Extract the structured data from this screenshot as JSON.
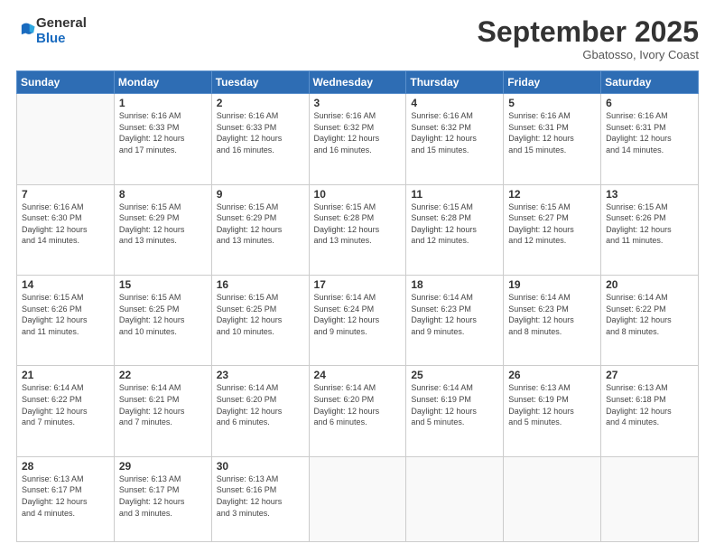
{
  "logo": {
    "general": "General",
    "blue": "Blue"
  },
  "header": {
    "month": "September 2025",
    "location": "Gbatosso, Ivory Coast"
  },
  "days_header": [
    "Sunday",
    "Monday",
    "Tuesday",
    "Wednesday",
    "Thursday",
    "Friday",
    "Saturday"
  ],
  "weeks": [
    [
      {
        "day": "",
        "info": ""
      },
      {
        "day": "1",
        "info": "Sunrise: 6:16 AM\nSunset: 6:33 PM\nDaylight: 12 hours\nand 17 minutes."
      },
      {
        "day": "2",
        "info": "Sunrise: 6:16 AM\nSunset: 6:33 PM\nDaylight: 12 hours\nand 16 minutes."
      },
      {
        "day": "3",
        "info": "Sunrise: 6:16 AM\nSunset: 6:32 PM\nDaylight: 12 hours\nand 16 minutes."
      },
      {
        "day": "4",
        "info": "Sunrise: 6:16 AM\nSunset: 6:32 PM\nDaylight: 12 hours\nand 15 minutes."
      },
      {
        "day": "5",
        "info": "Sunrise: 6:16 AM\nSunset: 6:31 PM\nDaylight: 12 hours\nand 15 minutes."
      },
      {
        "day": "6",
        "info": "Sunrise: 6:16 AM\nSunset: 6:31 PM\nDaylight: 12 hours\nand 14 minutes."
      }
    ],
    [
      {
        "day": "7",
        "info": "Sunrise: 6:16 AM\nSunset: 6:30 PM\nDaylight: 12 hours\nand 14 minutes."
      },
      {
        "day": "8",
        "info": "Sunrise: 6:15 AM\nSunset: 6:29 PM\nDaylight: 12 hours\nand 13 minutes."
      },
      {
        "day": "9",
        "info": "Sunrise: 6:15 AM\nSunset: 6:29 PM\nDaylight: 12 hours\nand 13 minutes."
      },
      {
        "day": "10",
        "info": "Sunrise: 6:15 AM\nSunset: 6:28 PM\nDaylight: 12 hours\nand 13 minutes."
      },
      {
        "day": "11",
        "info": "Sunrise: 6:15 AM\nSunset: 6:28 PM\nDaylight: 12 hours\nand 12 minutes."
      },
      {
        "day": "12",
        "info": "Sunrise: 6:15 AM\nSunset: 6:27 PM\nDaylight: 12 hours\nand 12 minutes."
      },
      {
        "day": "13",
        "info": "Sunrise: 6:15 AM\nSunset: 6:26 PM\nDaylight: 12 hours\nand 11 minutes."
      }
    ],
    [
      {
        "day": "14",
        "info": "Sunrise: 6:15 AM\nSunset: 6:26 PM\nDaylight: 12 hours\nand 11 minutes."
      },
      {
        "day": "15",
        "info": "Sunrise: 6:15 AM\nSunset: 6:25 PM\nDaylight: 12 hours\nand 10 minutes."
      },
      {
        "day": "16",
        "info": "Sunrise: 6:15 AM\nSunset: 6:25 PM\nDaylight: 12 hours\nand 10 minutes."
      },
      {
        "day": "17",
        "info": "Sunrise: 6:14 AM\nSunset: 6:24 PM\nDaylight: 12 hours\nand 9 minutes."
      },
      {
        "day": "18",
        "info": "Sunrise: 6:14 AM\nSunset: 6:23 PM\nDaylight: 12 hours\nand 9 minutes."
      },
      {
        "day": "19",
        "info": "Sunrise: 6:14 AM\nSunset: 6:23 PM\nDaylight: 12 hours\nand 8 minutes."
      },
      {
        "day": "20",
        "info": "Sunrise: 6:14 AM\nSunset: 6:22 PM\nDaylight: 12 hours\nand 8 minutes."
      }
    ],
    [
      {
        "day": "21",
        "info": "Sunrise: 6:14 AM\nSunset: 6:22 PM\nDaylight: 12 hours\nand 7 minutes."
      },
      {
        "day": "22",
        "info": "Sunrise: 6:14 AM\nSunset: 6:21 PM\nDaylight: 12 hours\nand 7 minutes."
      },
      {
        "day": "23",
        "info": "Sunrise: 6:14 AM\nSunset: 6:20 PM\nDaylight: 12 hours\nand 6 minutes."
      },
      {
        "day": "24",
        "info": "Sunrise: 6:14 AM\nSunset: 6:20 PM\nDaylight: 12 hours\nand 6 minutes."
      },
      {
        "day": "25",
        "info": "Sunrise: 6:14 AM\nSunset: 6:19 PM\nDaylight: 12 hours\nand 5 minutes."
      },
      {
        "day": "26",
        "info": "Sunrise: 6:13 AM\nSunset: 6:19 PM\nDaylight: 12 hours\nand 5 minutes."
      },
      {
        "day": "27",
        "info": "Sunrise: 6:13 AM\nSunset: 6:18 PM\nDaylight: 12 hours\nand 4 minutes."
      }
    ],
    [
      {
        "day": "28",
        "info": "Sunrise: 6:13 AM\nSunset: 6:17 PM\nDaylight: 12 hours\nand 4 minutes."
      },
      {
        "day": "29",
        "info": "Sunrise: 6:13 AM\nSunset: 6:17 PM\nDaylight: 12 hours\nand 3 minutes."
      },
      {
        "day": "30",
        "info": "Sunrise: 6:13 AM\nSunset: 6:16 PM\nDaylight: 12 hours\nand 3 minutes."
      },
      {
        "day": "",
        "info": ""
      },
      {
        "day": "",
        "info": ""
      },
      {
        "day": "",
        "info": ""
      },
      {
        "day": "",
        "info": ""
      }
    ]
  ]
}
